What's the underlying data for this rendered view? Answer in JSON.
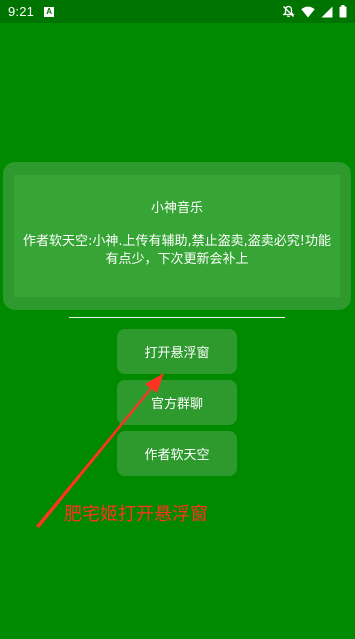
{
  "status_bar": {
    "time": "9:21",
    "notification_icon_label": "A",
    "icons": [
      "mute-icon",
      "wifi-icon",
      "signal-icon",
      "battery-icon"
    ]
  },
  "card": {
    "title": "小神音乐",
    "description": "作者软天空:小神.上传有辅助,禁止盗卖,盗卖必究!功能有点少，下次更新会补上"
  },
  "buttons": {
    "open_float": "打开悬浮窗",
    "official_group": "官方群聊",
    "author": "作者软天空"
  },
  "annotation": {
    "text": "肥宅姬打开悬浮窗",
    "color": "#ff3322"
  },
  "colors": {
    "background": "#008a00",
    "status_bar": "#007400",
    "card": "#2e9a2e",
    "card_inner": "#36a536",
    "button": "#2e9a2e"
  }
}
